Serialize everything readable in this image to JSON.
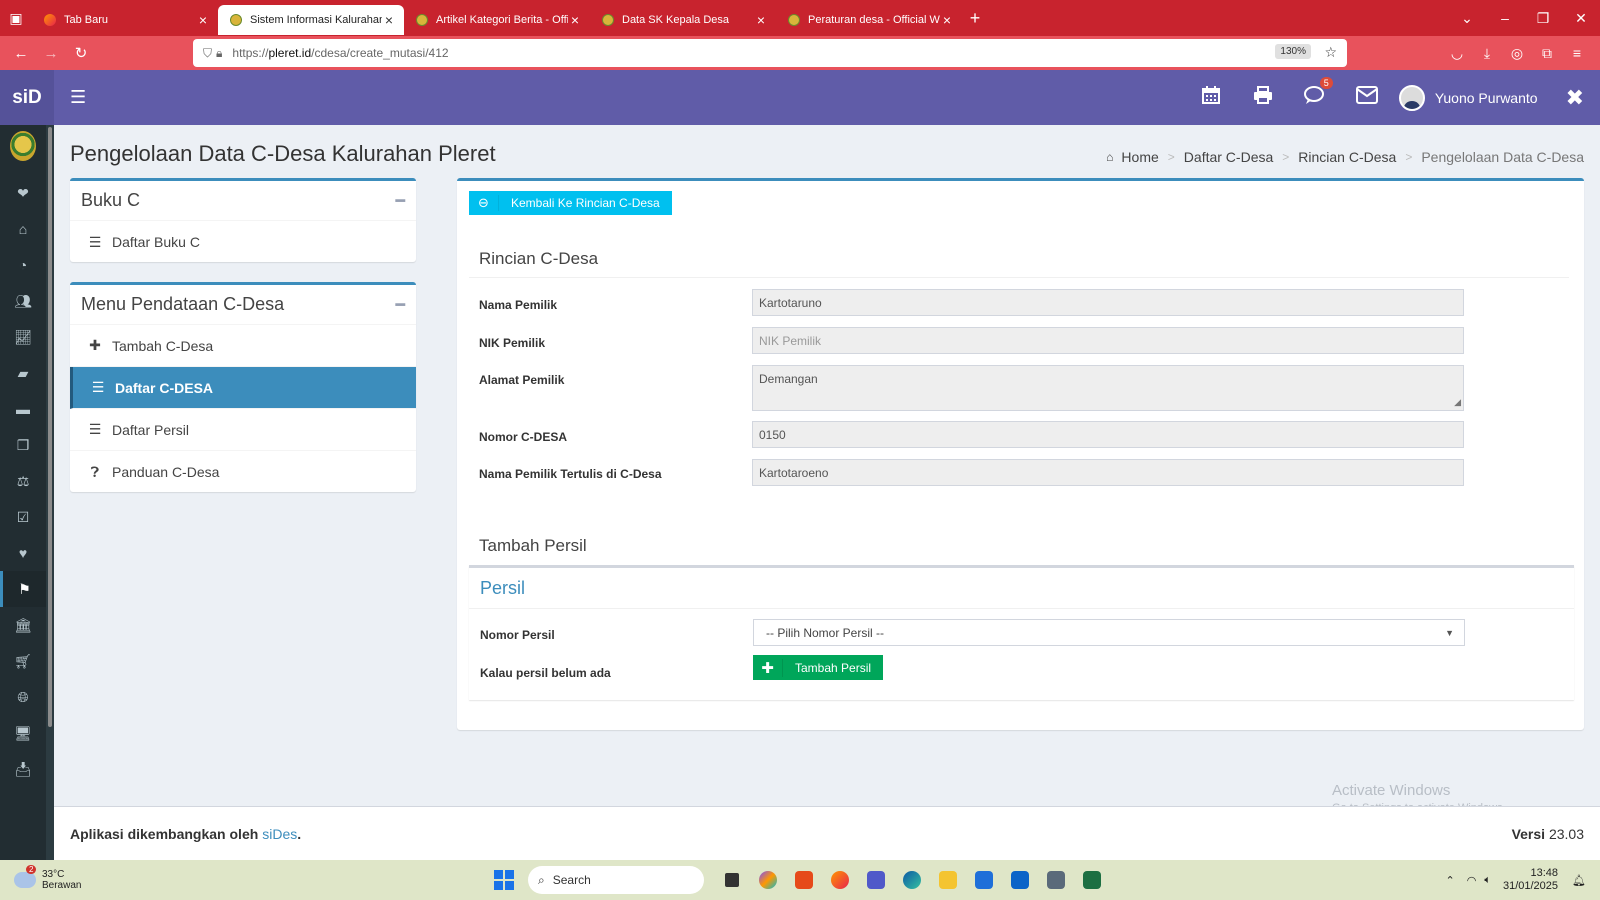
{
  "browser": {
    "tabs": [
      {
        "title": "Tab Baru",
        "active": false
      },
      {
        "title": "Sistem Informasi Kalurahan Pleret",
        "active": true
      },
      {
        "title": "Artikel Kategori Berita - Official",
        "active": false
      },
      {
        "title": "Data SK Kepala Desa",
        "active": false
      },
      {
        "title": "Peraturan desa - Official Website",
        "active": false
      }
    ],
    "url_prefix": "https://",
    "url_domain": "pleret.id",
    "url_path": "/cdesa/create_mutasi/412",
    "zoom": "130%"
  },
  "app": {
    "logo": "siD",
    "user_name": "Yuono Purwanto",
    "notification_count": "5",
    "accent_color": "#605ca8"
  },
  "page": {
    "title": "Pengelolaan Data C-Desa Kalurahan Pleret",
    "breadcrumb": [
      "Home",
      "Daftar C-Desa",
      "Rincian C-Desa",
      "Pengelolaan Data C-Desa"
    ]
  },
  "left_panel": {
    "buku_c_title": "Buku C",
    "buku_c_items": [
      "Daftar Buku C"
    ],
    "menu_title": "Menu Pendataan C-Desa",
    "menu_items": [
      "Tambah C-Desa",
      "Daftar C-DESA",
      "Daftar Persil",
      "Panduan C-Desa"
    ]
  },
  "main": {
    "back_button": "Kembali Ke Rincian C-Desa",
    "rincian_title": "Rincian C-Desa",
    "fields": {
      "nama_pemilik": {
        "label": "Nama Pemilik",
        "value": "Kartotaruno"
      },
      "nik_pemilik": {
        "label": "NIK Pemilik",
        "placeholder": "NIK Pemilik"
      },
      "alamat_pemilik": {
        "label": "Alamat Pemilik",
        "value": "Demangan"
      },
      "nomor_cdesa": {
        "label": "Nomor C-DESA",
        "value": "0150"
      },
      "nama_tertulis": {
        "label": "Nama Pemilik Tertulis di C-Desa",
        "value": "Kartotaroeno"
      }
    },
    "tambah_persil_title": "Tambah Persil",
    "persil_title": "Persil",
    "nomor_persil_label": "Nomor Persil",
    "nomor_persil_select": "-- Pilih Nomor Persil --",
    "belum_ada_label": "Kalau persil belum ada",
    "tambah_persil_button": "Tambah Persil"
  },
  "watermark": {
    "line1": "Activate Windows",
    "line2": "Go to Settings to activate Windows."
  },
  "footer": {
    "text": "Aplikasi dikembangkan oleh",
    "link": "siDes",
    "period": ".",
    "version_label": "Versi",
    "version": "23.03"
  },
  "taskbar": {
    "weather_temp": "33°C",
    "weather_desc": "Berawan",
    "weather_badge": "2",
    "search_label": "Search",
    "time": "13:48",
    "date": "31/01/2025"
  }
}
